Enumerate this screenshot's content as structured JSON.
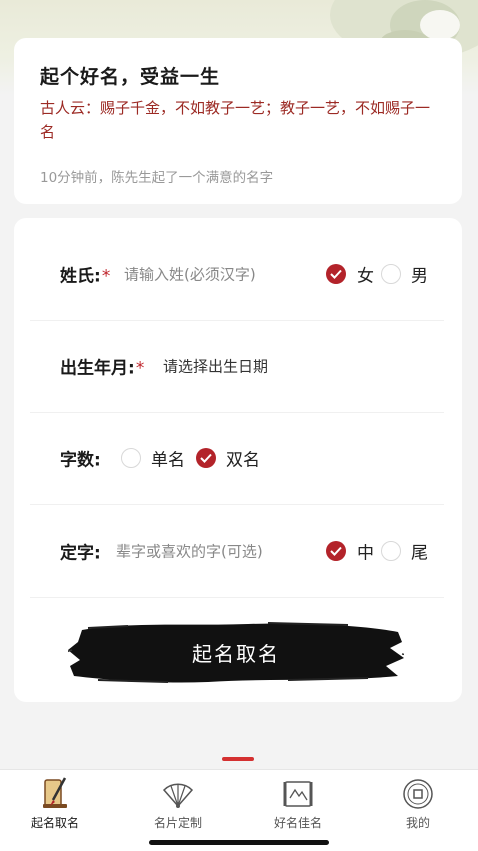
{
  "intro": {
    "title": "起个好名，受益一生",
    "quote": "古人云：赐子千金，不如教子一艺；教子一艺，不如赐子一名",
    "recent": "10分钟前，陈先生起了一个满意的名字"
  },
  "form": {
    "surname": {
      "label": "姓氏:",
      "required": "*",
      "placeholder": "请输入姓(必须汉字)"
    },
    "gender": {
      "options": [
        "女",
        "男"
      ],
      "selected": "女"
    },
    "birth": {
      "label": "出生年月:",
      "required": "*",
      "placeholder": "请选择出生日期"
    },
    "count": {
      "label": "字数:",
      "options": [
        "单名",
        "双名"
      ],
      "selected": "双名"
    },
    "fixed": {
      "label": "定字:",
      "placeholder": "辈字或喜欢的字(可选)",
      "options": [
        "中",
        "尾"
      ],
      "selected": "中"
    },
    "submit_label": "起名取名"
  },
  "tabs": [
    {
      "label": "起名取名",
      "icon": "brush-scroll-icon",
      "active": true
    },
    {
      "label": "名片定制",
      "icon": "fan-icon",
      "active": false
    },
    {
      "label": "好名佳名",
      "icon": "scroll-painting-icon",
      "active": false
    },
    {
      "label": "我的",
      "icon": "coin-icon",
      "active": false
    }
  ],
  "colors": {
    "accent": "#b3232a",
    "quote": "#9c2a24",
    "indicator": "#d43030"
  }
}
